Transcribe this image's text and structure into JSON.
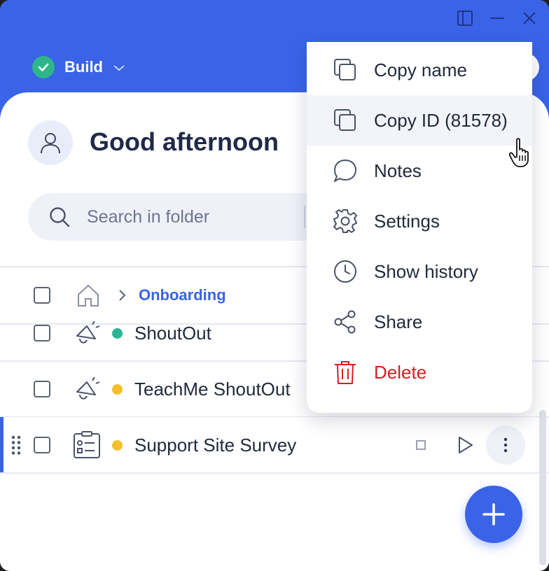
{
  "header": {
    "mode_label": "Build"
  },
  "greeting": "Good afternoon",
  "search": {
    "placeholder": "Search in folder"
  },
  "breadcrumb": {
    "current": "Onboarding"
  },
  "rows": [
    {
      "name": "ShoutOut",
      "status_color": "#2bb596"
    },
    {
      "name": "TeachMe ShoutOut",
      "status_color": "#f2c02c"
    },
    {
      "name": "Support Site Survey",
      "status_color": "#f2c02c"
    }
  ],
  "context_menu": {
    "items": [
      {
        "label": "Copy name",
        "icon": "copy-icon"
      },
      {
        "label": "Copy ID (81578)",
        "icon": "copy-icon"
      },
      {
        "label": "Notes",
        "icon": "chat-bubble-icon"
      },
      {
        "label": "Settings",
        "icon": "gear-icon"
      },
      {
        "label": "Show history",
        "icon": "clock-icon"
      },
      {
        "label": "Share",
        "icon": "share-icon"
      },
      {
        "label": "Delete",
        "icon": "trash-icon"
      }
    ]
  },
  "colors": {
    "brand": "#3a63e8",
    "danger": "#d61f1f",
    "success": "#2fb58a"
  }
}
